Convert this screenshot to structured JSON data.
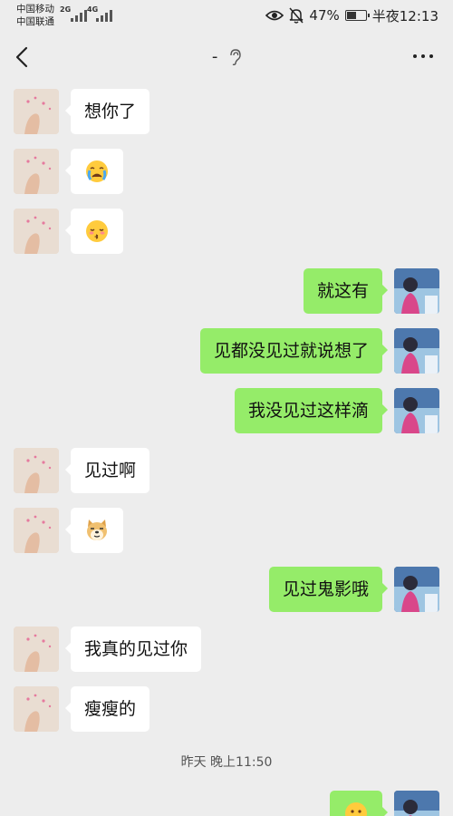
{
  "status_bar": {
    "carrier_1": "中国移动",
    "carrier_2": "中国联通",
    "signal_1": "2G",
    "signal_2": "4G",
    "battery": "47%",
    "time": "半夜12:13"
  },
  "nav": {
    "title": "-",
    "back_icon": "chevron-left-icon",
    "ear_icon": "ear-icon",
    "more_icon": "more-dots-icon"
  },
  "colors": {
    "background": "#ededed",
    "incoming_bubble": "#ffffff",
    "outgoing_bubble": "#95ec69"
  },
  "messages": [
    {
      "side": "left",
      "text": "想你了"
    },
    {
      "side": "left",
      "text": "😭",
      "emoji": "crying-face"
    },
    {
      "side": "left",
      "text": "😚",
      "emoji": "kissing-face"
    },
    {
      "side": "right",
      "text": "就这有"
    },
    {
      "side": "right",
      "text": "见都没见过就说想了"
    },
    {
      "side": "right",
      "text": "我没见过这样滴"
    },
    {
      "side": "left",
      "text": "见过啊"
    },
    {
      "side": "left",
      "text": "🐶",
      "emoji": "doge-face"
    },
    {
      "side": "right",
      "text": "见过鬼影哦"
    },
    {
      "side": "left",
      "text": "我真的见过你"
    },
    {
      "side": "left",
      "text": "瘦瘦的"
    },
    {
      "side": "right",
      "text": "😳",
      "emoji": "emoji-face"
    }
  ],
  "timestamp": "昨天 晚上11:50"
}
